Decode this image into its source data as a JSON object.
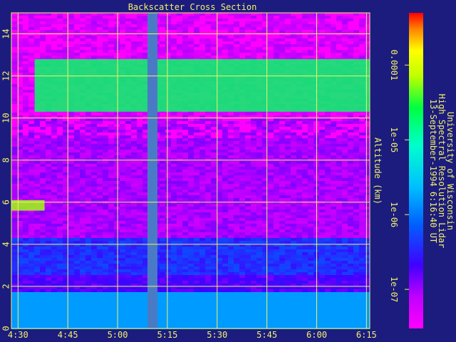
{
  "chart_data": {
    "type": "heatmap",
    "title": "Backscatter Cross Section",
    "ylabel": "Altitude (km)",
    "ylim": [
      0,
      15
    ],
    "xlim": [
      "4:28",
      "6:16"
    ],
    "x_ticks": [
      "4:30",
      "4:45",
      "5:00",
      "5:15",
      "5:30",
      "5:45",
      "6:00",
      "6:15"
    ],
    "y_ticks": [
      "0",
      "2",
      "4",
      "6",
      "8",
      "10",
      "12",
      "14"
    ],
    "grid": true,
    "colorbar": {
      "scale": "log",
      "range": [
        3e-08,
        0.0005
      ],
      "tick_labels": [
        "1e-07",
        "1e-06",
        "1e-05",
        "0.0001"
      ],
      "tick_values": [
        1e-07,
        1e-06,
        1e-05,
        0.0001
      ]
    },
    "annotation_lines": [
      "University of Wisconsin",
      "High Spectral Resolution Lidar",
      "13-September-1994  6:16:40 UT"
    ],
    "data_gap": {
      "start": "5:09",
      "end": "5:12"
    },
    "features": [
      {
        "name": "cirrus",
        "start": "4:35",
        "end": "6:16",
        "bottom_km": 10.3,
        "top_km": 12.8,
        "level": 2e-05
      },
      {
        "name": "aerosol-layer",
        "start": "4:28",
        "end": "4:38",
        "bottom_km": 5.6,
        "top_km": 6.1,
        "level": 6e-05
      },
      {
        "name": "boundary-layer",
        "start": "4:28",
        "end": "6:16",
        "bottom_km": 0.0,
        "top_km": 1.7,
        "level": 1.5e-06
      }
    ]
  },
  "colors": {
    "background": "#1c1c7e",
    "plot_frame": "#000000",
    "grid": "#f2f26a",
    "text": "#f2f26a",
    "gap_band": "#4a7ac6"
  }
}
